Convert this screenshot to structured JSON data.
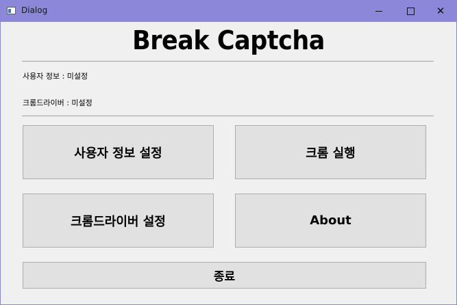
{
  "window": {
    "title": "Dialog",
    "controls": {
      "minimize_icon": "minimize-icon",
      "maximize_icon": "maximize-icon",
      "close_icon": "close-icon",
      "close_glyph": "✕"
    }
  },
  "main": {
    "heading": "Break Captcha",
    "user_info_status": "사용자 정보 : 미설정",
    "chrome_driver_status": "크롬드라이버 : 미설정"
  },
  "buttons": {
    "user_settings": "사용자 정보 설정",
    "run_chrome": "크롬 실행",
    "driver_settings": "크롬드라이버 설정",
    "about": "About",
    "exit": "종료"
  },
  "colors": {
    "titlebar": "#8c87d9",
    "window_bg": "#f0f0f0",
    "button_bg": "#e1e1e1",
    "button_border": "#adadad"
  }
}
